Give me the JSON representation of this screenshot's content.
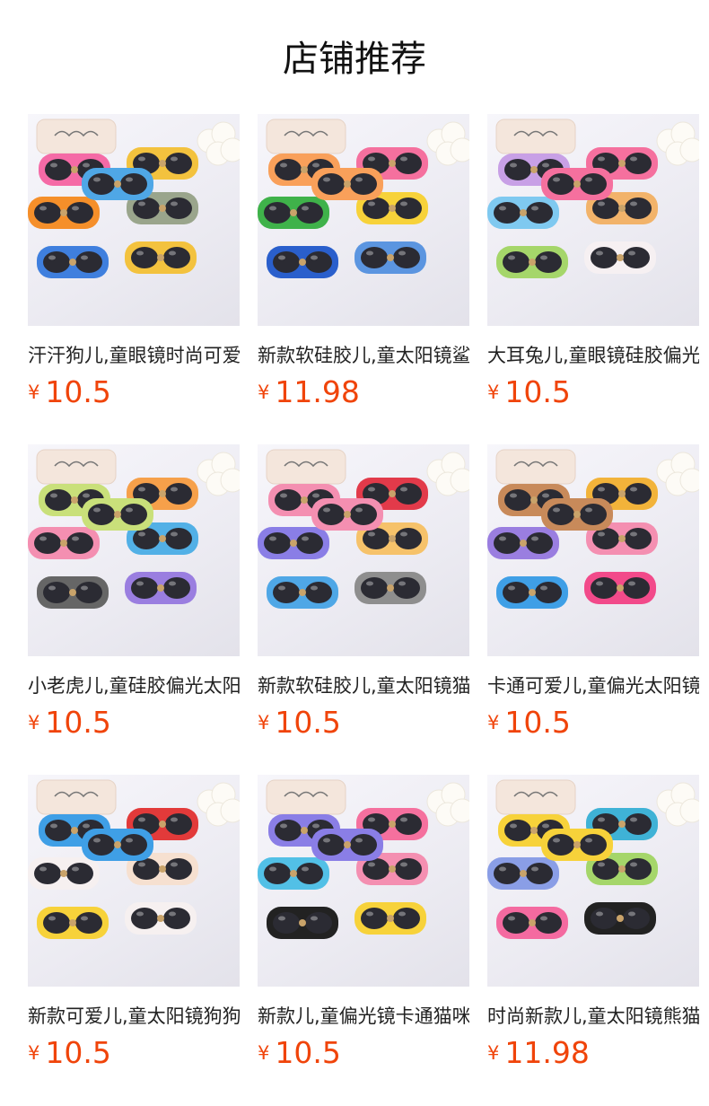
{
  "page_title": "店铺推荐",
  "colors": {
    "price": "#f0440a",
    "title": "#111111",
    "name": "#222222"
  },
  "products": [
    {
      "name": "汗汗狗儿,童眼镜时尚可爱",
      "currency": "¥",
      "price": "10.5",
      "image": "dog-sunglasses",
      "frames": [
        "#f56aa6",
        "#f3c23e",
        "#f58f2a",
        "#9aa58c",
        "#3f7fde",
        "#f3c23e",
        "#4fa7e6",
        "#f58f2a"
      ]
    },
    {
      "name": "新款软硅胶儿,童太阳镜鲨鱼",
      "currency": "¥",
      "price": "11.98",
      "image": "shark-sunglasses",
      "frames": [
        "#f9a05a",
        "#f5709e",
        "#3fb24a",
        "#f7d23a",
        "#2a5fcc",
        "#5b95e0",
        "#f9a05a",
        "#f7d23a"
      ]
    },
    {
      "name": "大耳兔儿,童眼镜硅胶偏光",
      "currency": "¥",
      "price": "10.5",
      "image": "rabbit-sunglasses",
      "frames": [
        "#c8a0e6",
        "#f5709e",
        "#7fc9f0",
        "#f2b36a",
        "#a5d66a",
        "#f6f0f2",
        "#f5709e",
        "#c8a0e6"
      ]
    },
    {
      "name": "小老虎儿,童硅胶偏光太阳镜",
      "currency": "¥",
      "price": "10.5",
      "image": "tiger-sunglasses",
      "frames": [
        "#c9e07a",
        "#f6a04a",
        "#f48fb1",
        "#52b0e6",
        "#666666",
        "#9a7ee0",
        "#c9e07a",
        "#f6a04a"
      ]
    },
    {
      "name": "新款软硅胶儿,童太阳镜猫咪",
      "currency": "¥",
      "price": "10.5",
      "image": "cat-sunglasses",
      "frames": [
        "#f48fb1",
        "#e23a4a",
        "#8a7ee6",
        "#f6c26a",
        "#4fa7e6",
        "#8e8e8e",
        "#f48fb1",
        "#e23a4a"
      ]
    },
    {
      "name": "卡通可爱儿,童偏光太阳镜",
      "currency": "¥",
      "price": "10.5",
      "image": "bear-sunglasses",
      "frames": [
        "#c88a5a",
        "#f2b33a",
        "#9a7ee0",
        "#f48fb1",
        "#3f9fe6",
        "#f24a8a",
        "#c88a5a",
        "#f2b33a"
      ]
    },
    {
      "name": "新款可爱儿,童太阳镜狗狗",
      "currency": "¥",
      "price": "10.5",
      "image": "puppy-sunglasses",
      "frames": [
        "#3f9fe6",
        "#e23a3a",
        "#f6f0f0",
        "#f6e0d0",
        "#f7d23a",
        "#f6f0f0",
        "#3f9fe6",
        "#e23a3a"
      ]
    },
    {
      "name": "新款儿,童偏光镜卡通猫咪",
      "currency": "¥",
      "price": "10.5",
      "image": "bow-sunglasses",
      "frames": [
        "#8a7ee6",
        "#f5709e",
        "#52c0e6",
        "#f48fb1",
        "#222222",
        "#f7d23a",
        "#8a7ee6",
        "#f5709e"
      ]
    },
    {
      "name": "时尚新款儿,童太阳镜熊猫",
      "currency": "¥",
      "price": "11.98",
      "image": "panda-sunglasses",
      "frames": [
        "#f7d23a",
        "#3fb2d6",
        "#8a9ee6",
        "#a5d66a",
        "#f46aa0",
        "#222222",
        "#f7d23a",
        "#3fb2d6"
      ]
    }
  ]
}
